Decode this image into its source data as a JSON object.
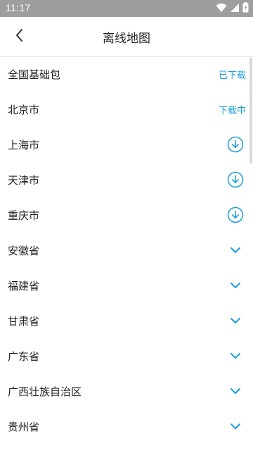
{
  "status_bar": {
    "time": "11:17"
  },
  "header": {
    "title": "离线地图"
  },
  "accent_color": "#1aa0d8",
  "items": [
    {
      "name": "全国基础包",
      "status": "已下载",
      "action": "status-text"
    },
    {
      "name": "北京市",
      "status": "下载中",
      "action": "status-text"
    },
    {
      "name": "上海市",
      "action": "download-circle-icon"
    },
    {
      "name": "天津市",
      "action": "download-circle-icon"
    },
    {
      "name": "重庆市",
      "action": "download-circle-icon"
    },
    {
      "name": "安徽省",
      "action": "chevron-down-icon"
    },
    {
      "name": "福建省",
      "action": "chevron-down-icon"
    },
    {
      "name": "甘肃省",
      "action": "chevron-down-icon"
    },
    {
      "name": "广东省",
      "action": "chevron-down-icon"
    },
    {
      "name": "广西壮族自治区",
      "action": "chevron-down-icon"
    },
    {
      "name": "贵州省",
      "action": "chevron-down-icon"
    }
  ]
}
